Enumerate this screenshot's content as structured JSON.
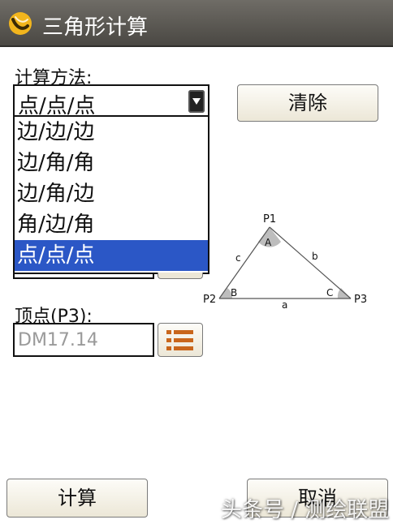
{
  "window": {
    "title": "三角形计算",
    "icon": "app-logo-icon"
  },
  "method": {
    "label": "计算方法:",
    "selected": "点/点/点",
    "options": [
      "边/边/边",
      "边/角/角",
      "边/角/边",
      "角/边/角",
      "点/点/点"
    ]
  },
  "buttons": {
    "clear": "清除",
    "calculate": "计算",
    "cancel": "取消"
  },
  "vertex": {
    "label": "顶点(P3):",
    "value": "DM17.14",
    "list_icon": "list-icon"
  },
  "diagram": {
    "p1": "P1",
    "p2": "P2",
    "p3": "P3",
    "angle_a": "A",
    "angle_b": "B",
    "angle_c": "C",
    "side_a": "a",
    "side_b": "b",
    "side_c": "c"
  },
  "watermark": "头条号 / 测绘联盟",
  "colors": {
    "titlebar": "#5c5a55",
    "selection": "#2b57c6"
  }
}
